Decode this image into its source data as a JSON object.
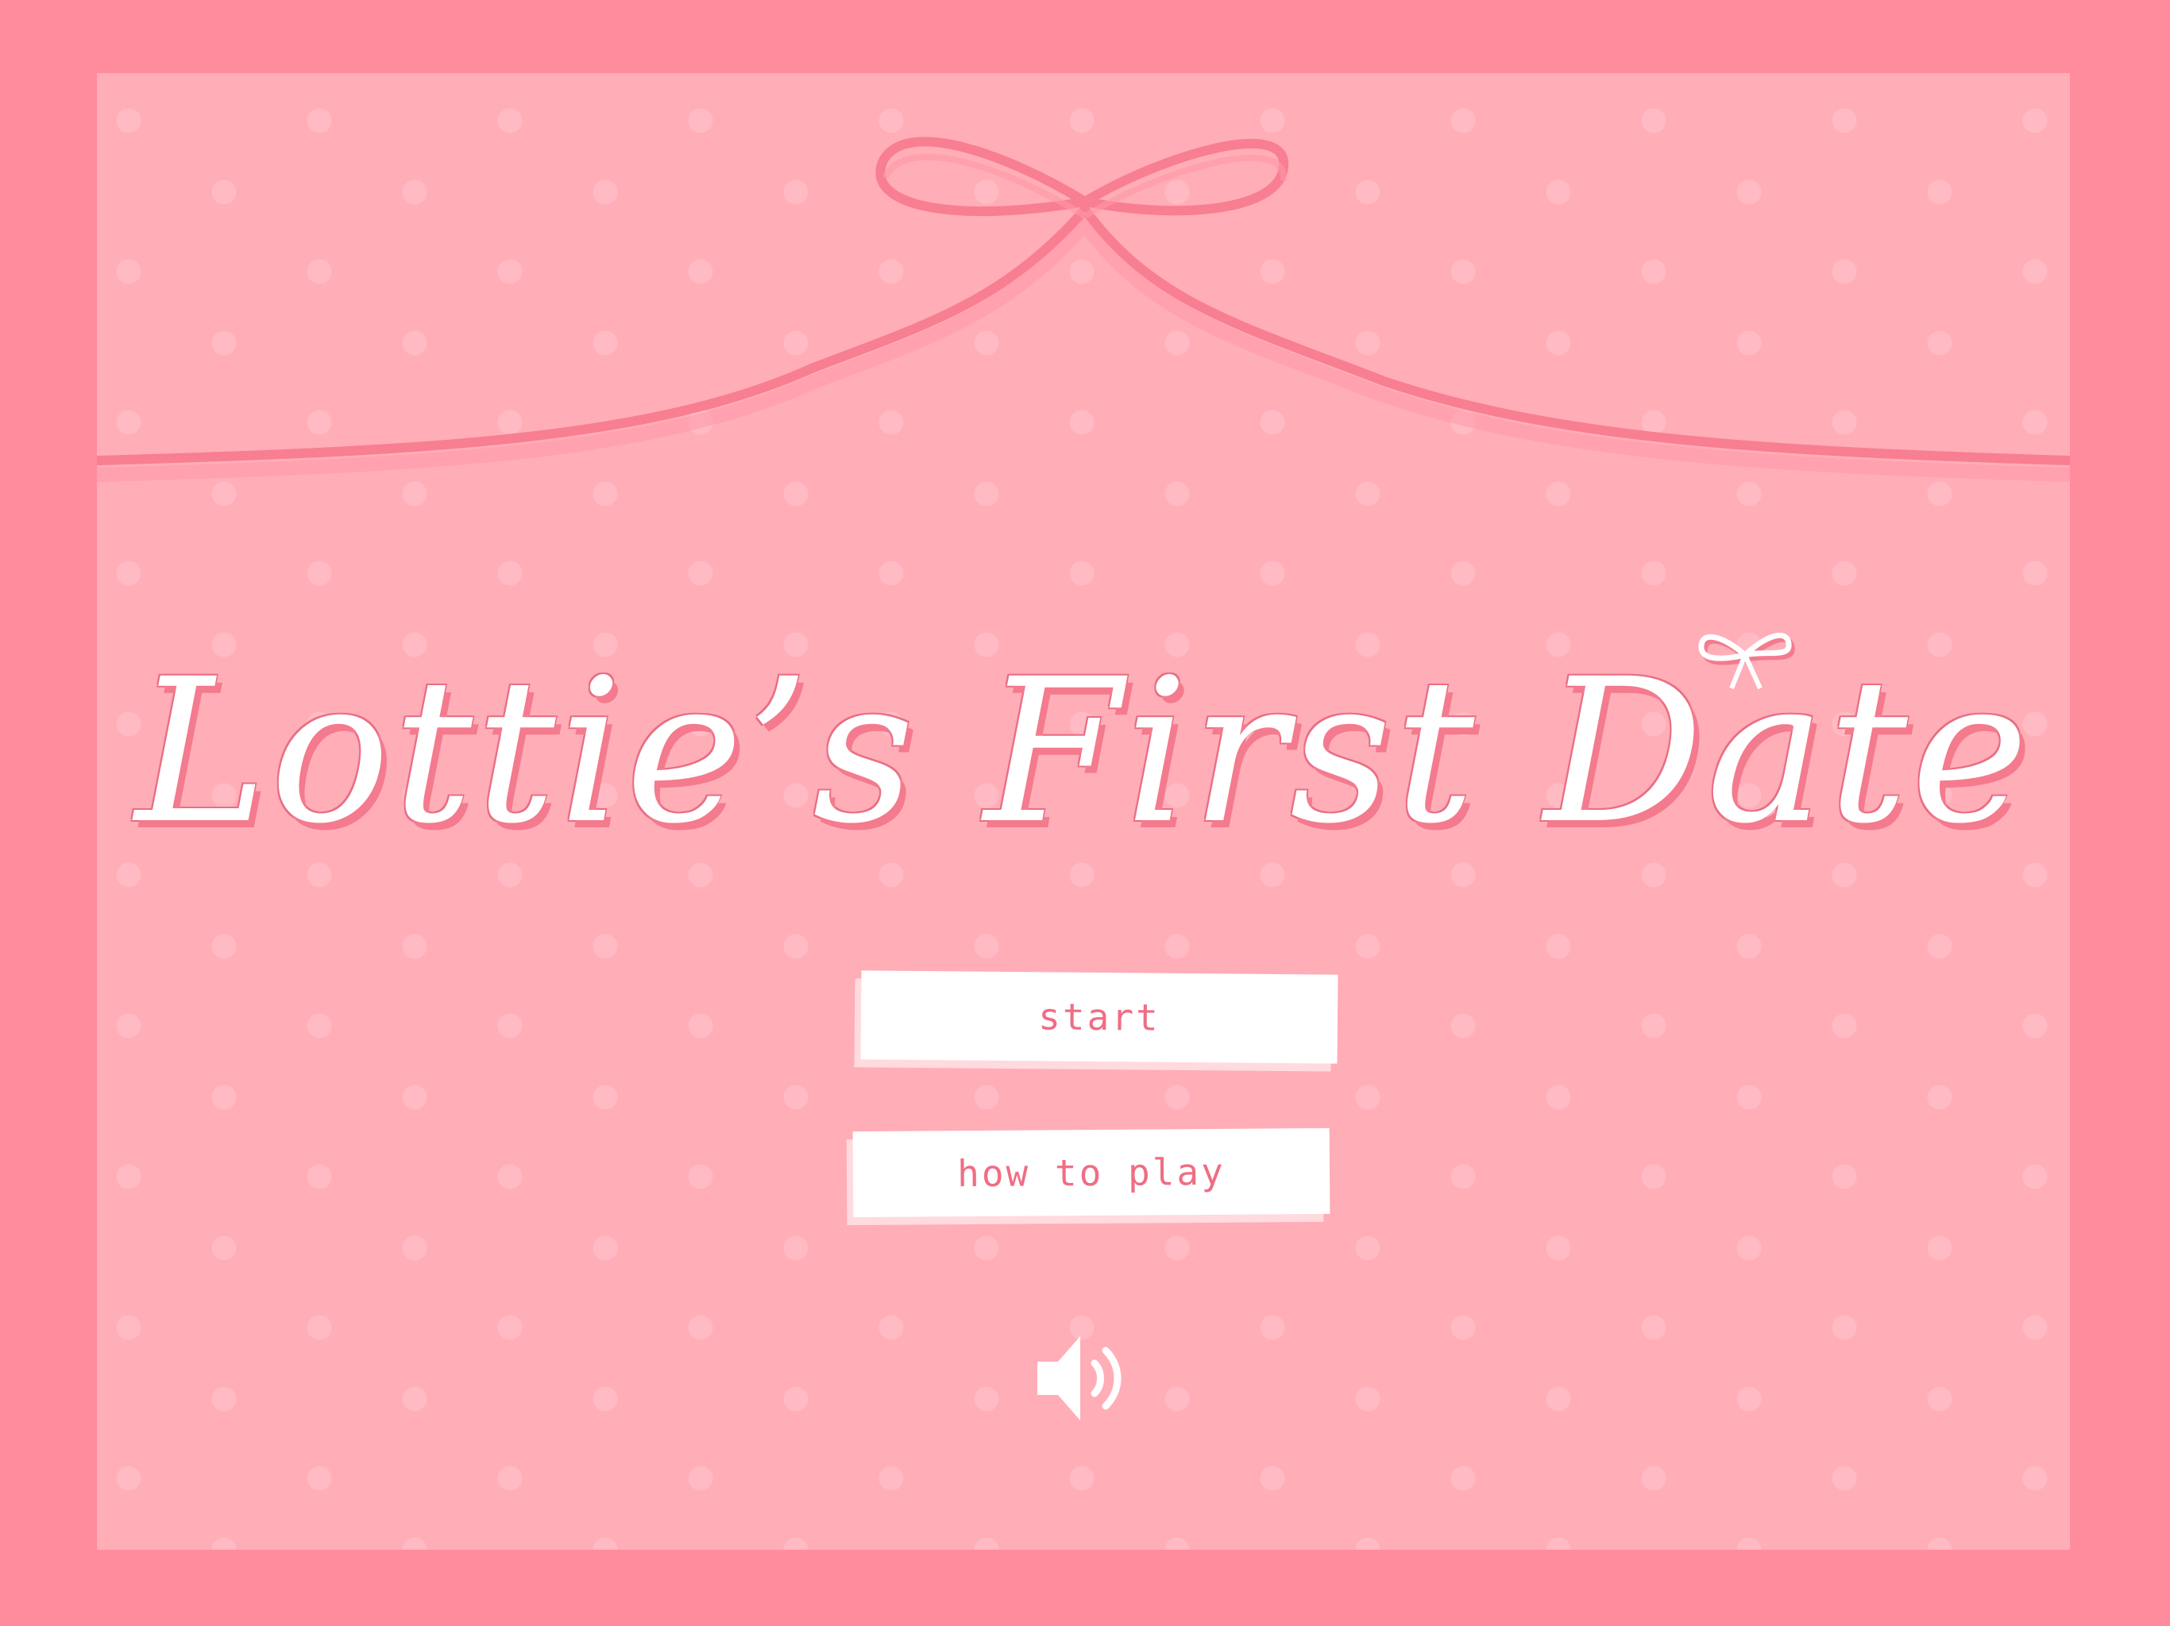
{
  "game": {
    "title": "Lottie’s First Date"
  },
  "menu": {
    "start_label": "start",
    "how_to_play_label": "how to play"
  },
  "icons": {
    "title_bow": "bow-icon",
    "sound": "speaker-volume-icon",
    "top_ribbon": "ribbon-bow-icon"
  },
  "colors": {
    "frame": "#ff8c9c",
    "background": "#ffadb7",
    "ribbon": "#f87e92",
    "button_text": "#ef6e84",
    "title_text": "#ffffff"
  }
}
